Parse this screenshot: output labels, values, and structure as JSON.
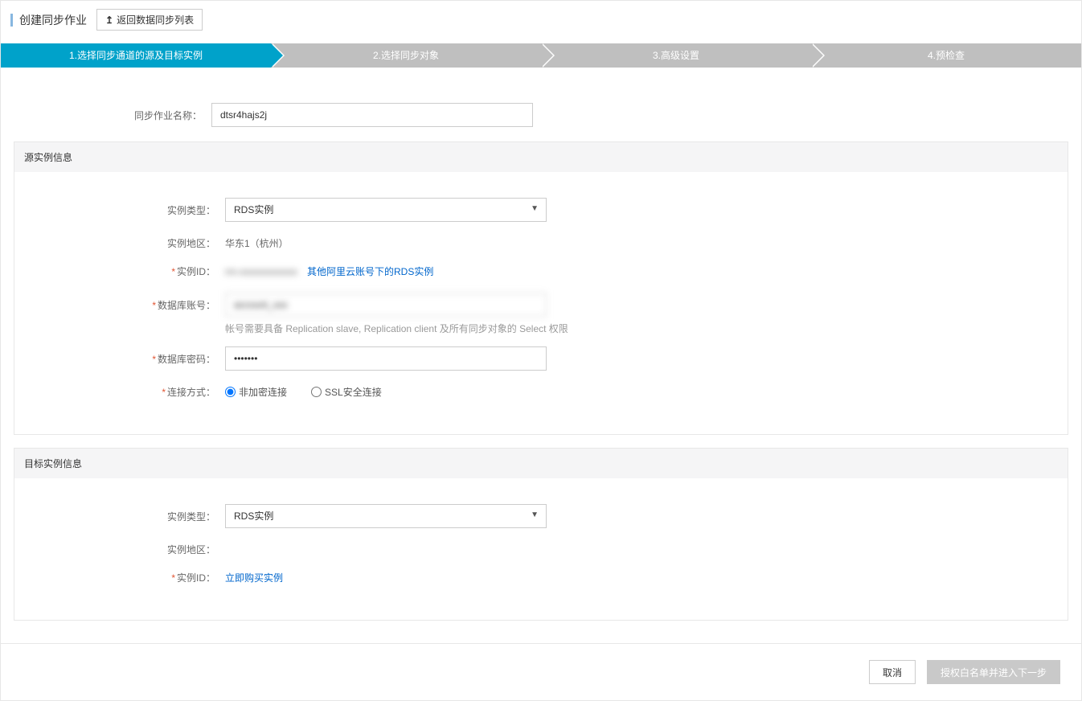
{
  "header": {
    "title": "创建同步作业",
    "back_label": "返回数据同步列表"
  },
  "steps": [
    "1.选择同步通道的源及目标实例",
    "2.选择同步对象",
    "3.高级设置",
    "4.预检查"
  ],
  "top_form": {
    "job_name_label": "同步作业名称：",
    "job_name_value": "dtsr4hajs2j"
  },
  "source_panel": {
    "title": "源实例信息",
    "instance_type_label": "实例类型：",
    "instance_type_value": "RDS实例",
    "region_label": "实例地区：",
    "region_value": "华东1（杭州）",
    "instance_id_label": "实例ID：",
    "instance_id_value": "rm-xxxxxxxxxxxx",
    "other_rds_link": "其他阿里云账号下的RDS实例",
    "db_account_label": "数据库账号：",
    "db_account_value": "account_xxx",
    "db_account_hint": "帐号需要具备 Replication slave, Replication client 及所有同步对象的 Select 权限",
    "db_password_label": "数据库密码：",
    "db_password_value": "•••••••",
    "conn_mode_label": "连接方式：",
    "conn_mode_option1": "非加密连接",
    "conn_mode_option2": "SSL安全连接"
  },
  "target_panel": {
    "title": "目标实例信息",
    "instance_type_label": "实例类型：",
    "instance_type_value": "RDS实例",
    "region_label": "实例地区：",
    "region_value": "",
    "instance_id_label": "实例ID：",
    "buy_link": "立即购买实例"
  },
  "footer": {
    "cancel": "取消",
    "next": "授权白名单并进入下一步"
  }
}
